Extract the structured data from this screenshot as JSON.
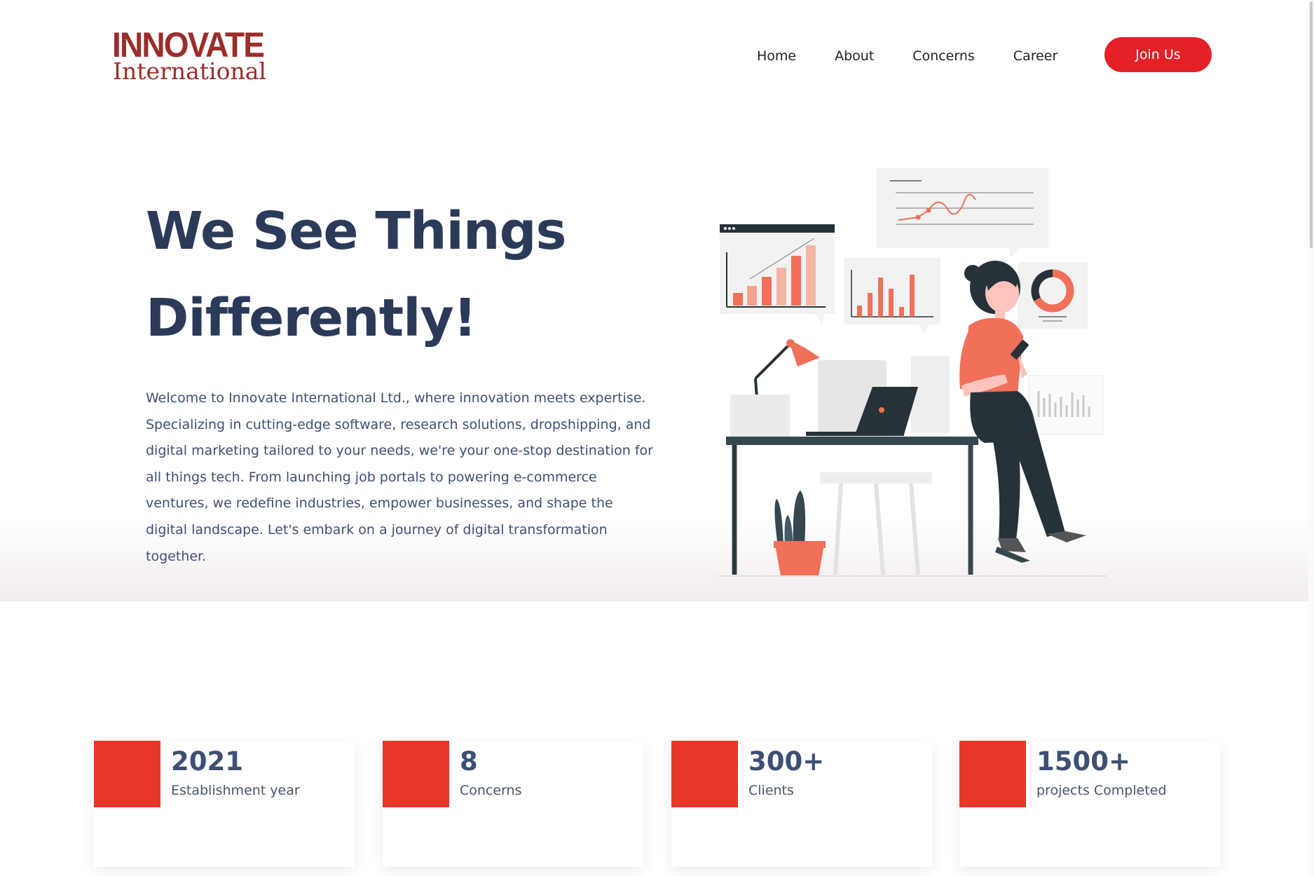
{
  "brand": {
    "logo_top": "INNOVATE",
    "logo_bottom": "International",
    "color": "#9b2d2a"
  },
  "nav": {
    "items": [
      "Home",
      "About",
      "Concerns",
      "Career"
    ],
    "cta": "Join Us",
    "cta_color": "#e32127"
  },
  "hero": {
    "title_line1": "We See Things",
    "title_line2": "Differently!",
    "description": "Welcome to Innovate International Ltd., where innovation meets expertise. Specializing in cutting-edge software, research solutions, dropshipping, and digital marketing tailored to your needs, we're your one-stop destination for all things tech. From launching job portals to powering e-commerce ventures, we redefine industries, empower businesses, and shape the digital landscape. Let's embark on a journey of digital transformation together.",
    "illustration": "woman-at-desk-with-charts-illustration"
  },
  "stats": [
    {
      "value": "2021",
      "label": "Establishment year"
    },
    {
      "value": "8",
      "label": "Concerns"
    },
    {
      "value": "300+",
      "label": "Clients"
    },
    {
      "value": "1500+",
      "label": "projects Completed"
    }
  ],
  "colors": {
    "title": "#2b3a59",
    "body": "#3e4f73",
    "accent": "#e8362b"
  }
}
